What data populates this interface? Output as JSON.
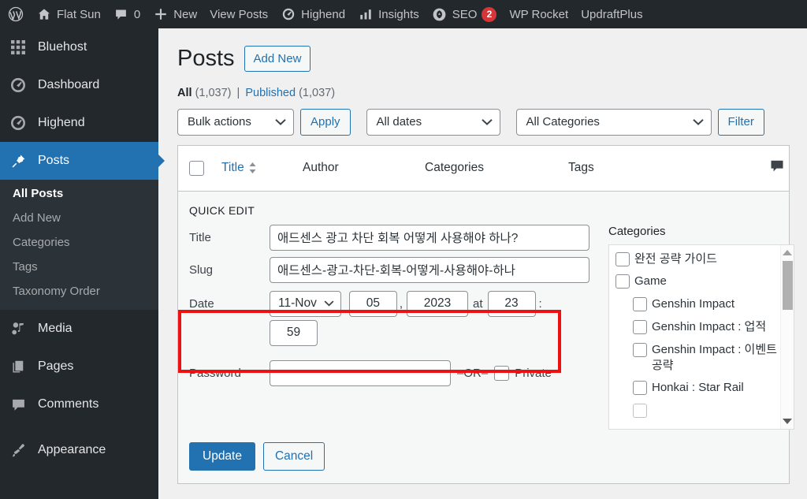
{
  "adminbar": {
    "items": [
      {
        "id": "wp-logo",
        "icon": "wordpress-icon",
        "label": ""
      },
      {
        "id": "site-name",
        "icon": "home-icon",
        "label": "Flat Sun"
      },
      {
        "id": "comments",
        "icon": "comment-icon",
        "label": "0"
      },
      {
        "id": "new-content",
        "icon": "plus-icon",
        "label": "New"
      },
      {
        "id": "view-posts",
        "icon": "",
        "label": "View Posts"
      },
      {
        "id": "highend",
        "icon": "gauge-icon",
        "label": "Highend"
      },
      {
        "id": "insights",
        "icon": "bar-chart-icon",
        "label": "Insights"
      },
      {
        "id": "seo",
        "icon": "seo-icon",
        "label": "SEO",
        "badge": "2"
      },
      {
        "id": "wp-rocket",
        "icon": "",
        "label": "WP Rocket"
      },
      {
        "id": "updraftplus",
        "icon": "",
        "label": "UpdraftPlus"
      }
    ]
  },
  "sidebar": {
    "items": [
      {
        "label": "Bluehost",
        "icon": "grid-icon",
        "current": false
      },
      {
        "label": "Dashboard",
        "icon": "gauge-icon",
        "current": false
      },
      {
        "label": "Highend",
        "icon": "gauge-icon",
        "current": false
      },
      {
        "label": "Posts",
        "icon": "pin-icon",
        "current": true
      }
    ],
    "submenu": [
      {
        "label": "All Posts",
        "current": true
      },
      {
        "label": "Add New",
        "current": false
      },
      {
        "label": "Categories",
        "current": false
      },
      {
        "label": "Tags",
        "current": false
      },
      {
        "label": "Taxonomy Order",
        "current": false
      }
    ],
    "items_after": [
      {
        "label": "Media",
        "icon": "media-icon"
      },
      {
        "label": "Pages",
        "icon": "pages-icon"
      },
      {
        "label": "Comments",
        "icon": "comment-icon"
      },
      {
        "label": "Appearance",
        "icon": "brush-icon"
      }
    ]
  },
  "page": {
    "title": "Posts",
    "add_new": "Add New",
    "views": {
      "all_label": "All",
      "all_count": "(1,037)",
      "separator": "|",
      "published_label": "Published",
      "published_count": "(1,037)"
    }
  },
  "tablenav": {
    "bulk_actions": "Bulk actions",
    "apply": "Apply",
    "all_dates": "All dates",
    "all_categories": "All Categories",
    "filter": "Filter"
  },
  "table": {
    "headers": {
      "title": "Title",
      "author": "Author",
      "categories": "Categories",
      "tags": "Tags",
      "comments_icon": "comment-icon"
    }
  },
  "quick_edit": {
    "legend": "QUICK EDIT",
    "title_label": "Title",
    "title_value": "애드센스 광고 차단 회복 어떻게 사용해야 하나?",
    "slug_label": "Slug",
    "slug_value": "애드센스-광고-차단-회복-어떻게-사용해야-하나",
    "date_label": "Date",
    "date_month": "11-Nov",
    "date_day": "05",
    "date_comma": ",",
    "date_year": "2023",
    "date_at": "at",
    "date_hour": "23",
    "date_colon": ":",
    "date_minute": "59",
    "password_label": "Password",
    "password_value": "",
    "or_label": "–OR–",
    "private_label": "Private",
    "update": "Update",
    "cancel": "Cancel"
  },
  "categories_panel": {
    "title": "Categories",
    "items": [
      {
        "label": "완전 공략 가이드",
        "level": 0,
        "checked": false
      },
      {
        "label": "Game",
        "level": 0,
        "checked": false
      },
      {
        "label": "Genshin Impact",
        "level": 1,
        "checked": false
      },
      {
        "label": "Genshin Impact : 업적",
        "level": 1,
        "checked": false
      },
      {
        "label": "Genshin Impact : 이벤트 공략",
        "level": 1,
        "checked": false
      },
      {
        "label": "Honkai : Star Rail",
        "level": 1,
        "checked": false
      }
    ]
  },
  "colors": {
    "accent": "#2271b1",
    "admin_bg": "#23282d",
    "highlight": "#ee1111",
    "badge": "#d63638"
  }
}
